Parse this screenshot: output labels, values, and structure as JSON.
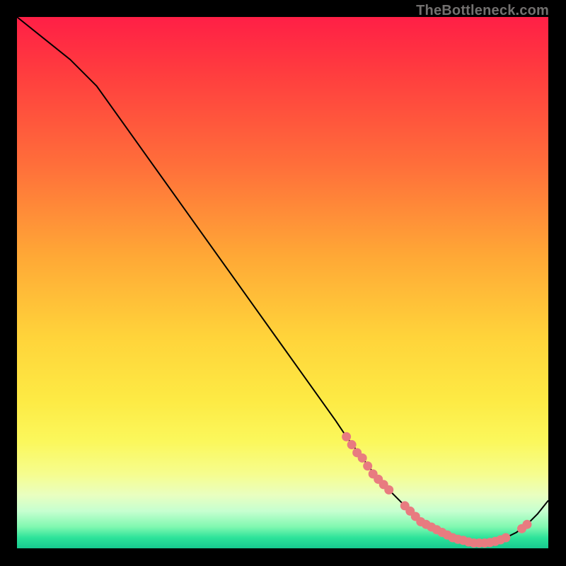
{
  "watermark": "TheBottleneck.com",
  "colors": {
    "background": "#000000",
    "gradient_top": "#ff1f46",
    "gradient_mid": "#ffd33a",
    "gradient_bottom": "#17c98f",
    "curve": "#000000",
    "markers": "#e87b80"
  },
  "chart_data": {
    "type": "line",
    "title": "",
    "xlabel": "",
    "ylabel": "",
    "xlim": [
      0,
      100
    ],
    "ylim": [
      0,
      100
    ],
    "series": [
      {
        "name": "bottleneck-curve",
        "x": [
          0,
          5,
          10,
          15,
          20,
          25,
          30,
          35,
          40,
          45,
          50,
          55,
          60,
          62,
          65,
          68,
          70,
          73,
          75,
          78,
          80,
          82,
          84,
          86,
          88,
          90,
          92,
          94,
          96,
          98,
          100
        ],
        "y": [
          100,
          96,
          92,
          87,
          80,
          73,
          66,
          59,
          52,
          45,
          38,
          31,
          24,
          21,
          17,
          13,
          11,
          8,
          6,
          4,
          3,
          2,
          1.5,
          1,
          1,
          1.3,
          2,
          3,
          4.5,
          6.5,
          9
        ]
      }
    ],
    "markers": [
      {
        "series": "bottleneck-curve",
        "x_range": [
          62,
          70
        ],
        "note": "descending cluster (left)"
      },
      {
        "series": "bottleneck-curve",
        "x_range": [
          72,
          92
        ],
        "note": "trough dense cluster"
      },
      {
        "series": "bottleneck-curve",
        "x_points": [
          95,
          96
        ],
        "note": "ascending right segment"
      }
    ],
    "marker_points": [
      {
        "x": 62,
        "y": 21
      },
      {
        "x": 63,
        "y": 19.5
      },
      {
        "x": 64,
        "y": 18
      },
      {
        "x": 65,
        "y": 17
      },
      {
        "x": 66,
        "y": 15.5
      },
      {
        "x": 67,
        "y": 14
      },
      {
        "x": 68,
        "y": 13
      },
      {
        "x": 69,
        "y": 12
      },
      {
        "x": 70,
        "y": 11
      },
      {
        "x": 73,
        "y": 8
      },
      {
        "x": 74,
        "y": 7
      },
      {
        "x": 75,
        "y": 6
      },
      {
        "x": 76,
        "y": 5
      },
      {
        "x": 77,
        "y": 4.5
      },
      {
        "x": 78,
        "y": 4
      },
      {
        "x": 79,
        "y": 3.5
      },
      {
        "x": 80,
        "y": 3
      },
      {
        "x": 81,
        "y": 2.5
      },
      {
        "x": 82,
        "y": 2
      },
      {
        "x": 83,
        "y": 1.7
      },
      {
        "x": 84,
        "y": 1.5
      },
      {
        "x": 85,
        "y": 1.2
      },
      {
        "x": 86,
        "y": 1
      },
      {
        "x": 87,
        "y": 1
      },
      {
        "x": 88,
        "y": 1
      },
      {
        "x": 89,
        "y": 1.1
      },
      {
        "x": 90,
        "y": 1.3
      },
      {
        "x": 91,
        "y": 1.6
      },
      {
        "x": 92,
        "y": 2
      },
      {
        "x": 95,
        "y": 3.7
      },
      {
        "x": 96,
        "y": 4.5
      }
    ]
  }
}
